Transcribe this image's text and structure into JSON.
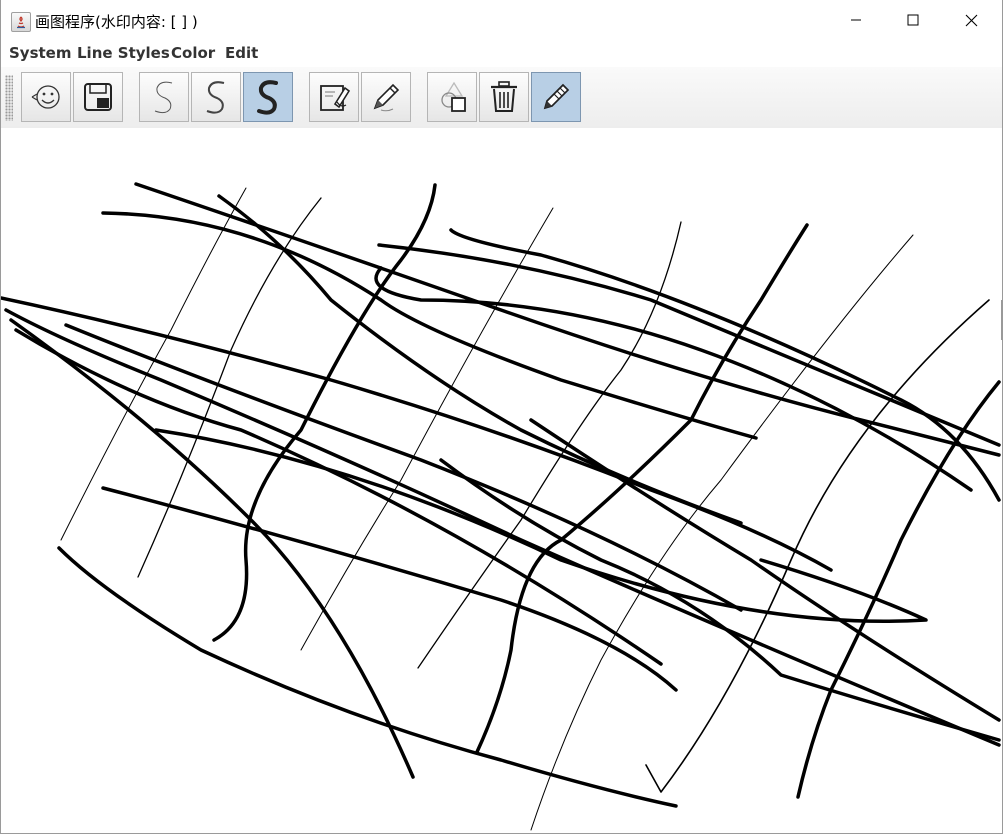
{
  "window": {
    "title": "画图程序(水印内容: [ ] )",
    "buttons": [
      "minimize",
      "maximize",
      "close"
    ]
  },
  "menubar": {
    "items": [
      "System",
      "Line Styles",
      "Color",
      "Edit"
    ]
  },
  "toolbar": {
    "buttons": [
      {
        "icon": "smiley-icon",
        "selected": false
      },
      {
        "icon": "save-icon",
        "selected": false
      },
      {
        "icon": "thin-line-icon",
        "selected": false
      },
      {
        "icon": "medium-line-icon",
        "selected": false
      },
      {
        "icon": "thick-line-icon",
        "selected": true
      },
      {
        "icon": "color-picker-icon",
        "selected": false
      },
      {
        "icon": "pencil-icon",
        "selected": false
      },
      {
        "icon": "shapes-icon",
        "selected": false
      },
      {
        "icon": "trash-icon",
        "selected": false
      },
      {
        "icon": "pen-icon",
        "selected": true
      }
    ]
  },
  "colors": {
    "stroke": "#000000",
    "selected_button": "#b8cfe5",
    "canvas": "#ffffff"
  }
}
